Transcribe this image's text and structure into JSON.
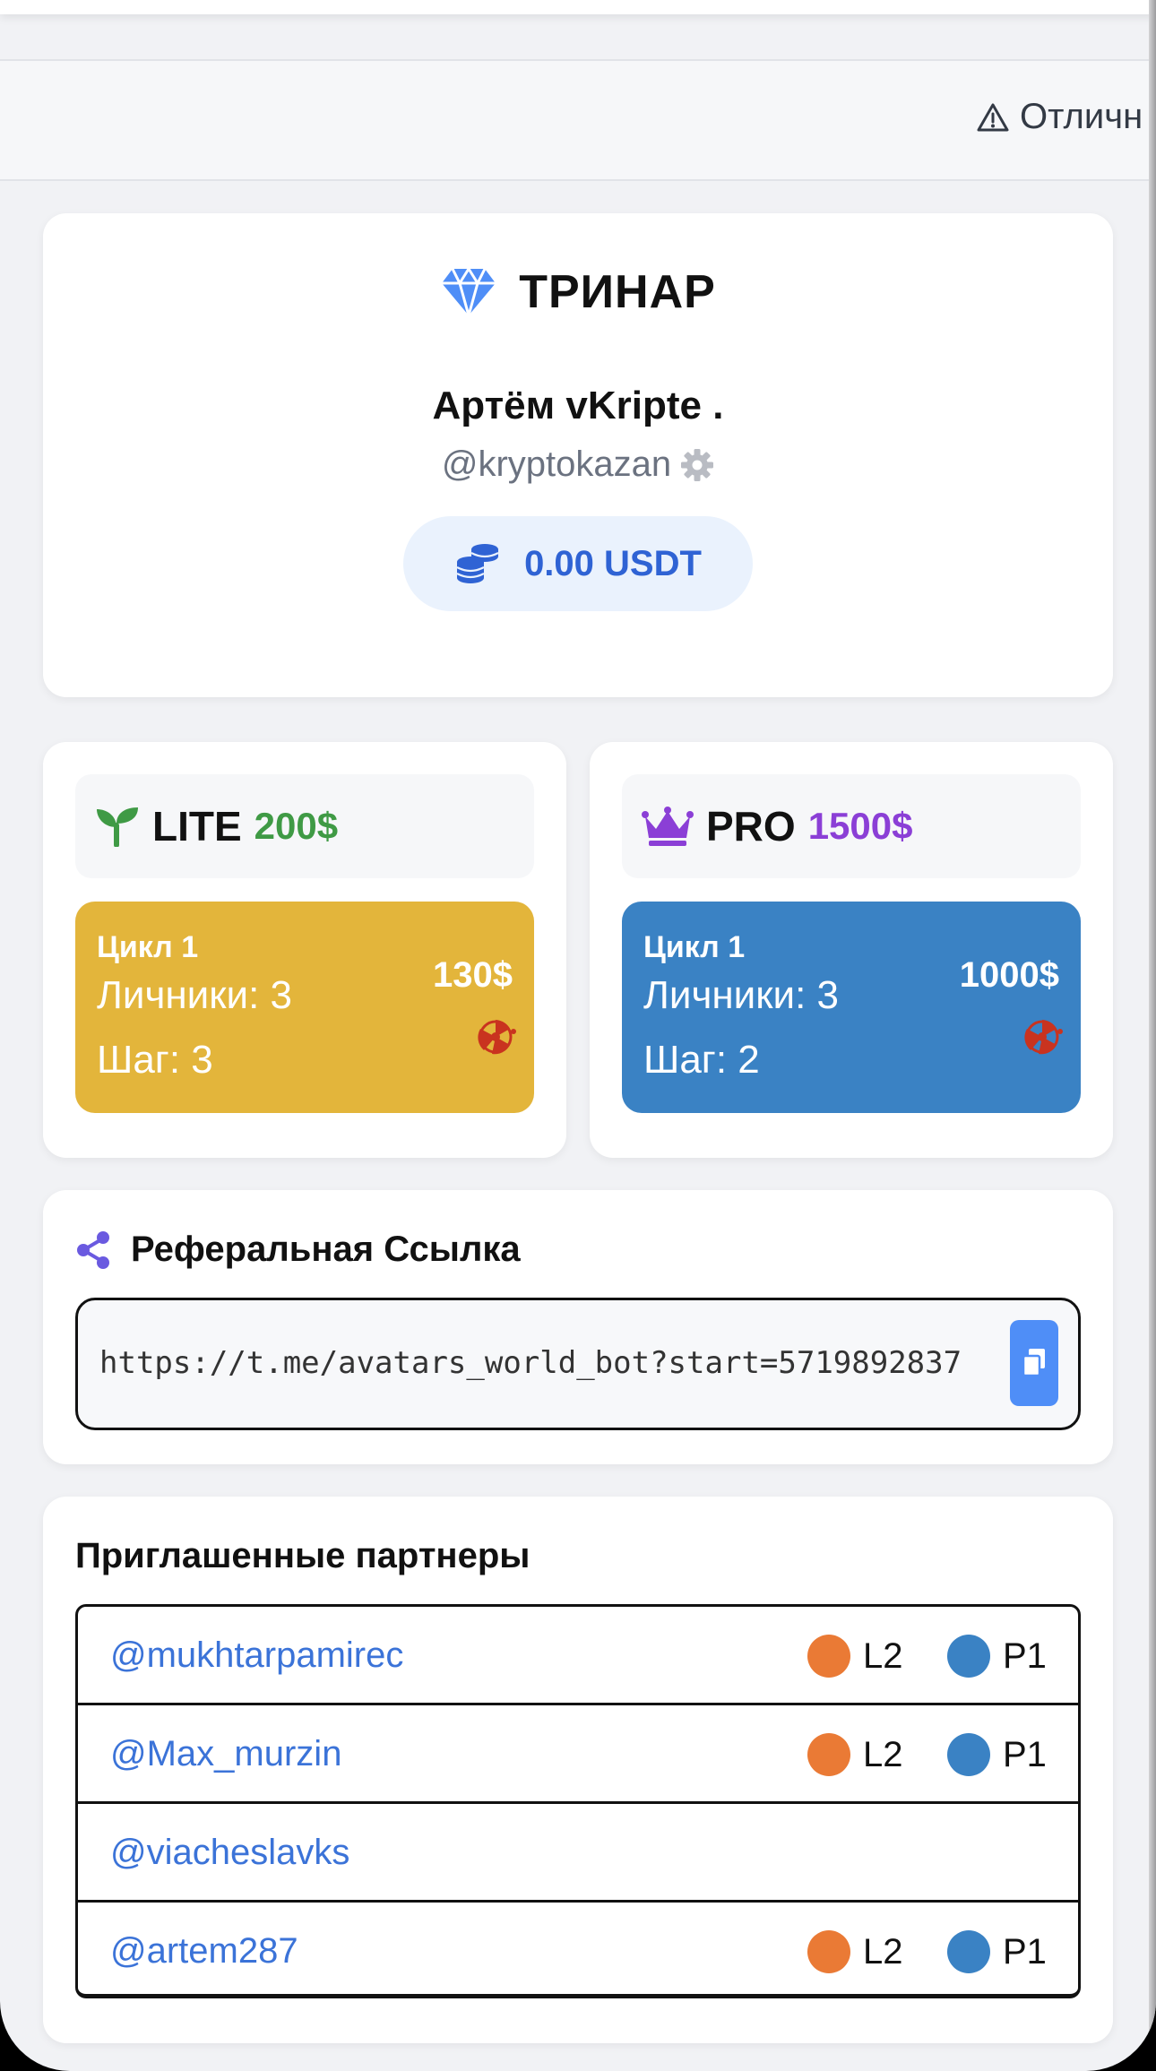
{
  "ticker": {
    "text": "Отличн"
  },
  "profile": {
    "brand": "ТРИНАР",
    "name": "Артём vKripte .",
    "handle": "@kryptokazan",
    "balance": "0.00 USDT"
  },
  "plans": {
    "lite": {
      "name": "LITE",
      "price": "200$",
      "cycle_title": "Цикл 1",
      "line1": "Личники: 3",
      "line2": "Шаг: 3",
      "amount": "130$"
    },
    "pro": {
      "name": "PRO",
      "price": "1500$",
      "cycle_title": "Цикл 1",
      "line1": "Личники: 3",
      "line2": "Шаг: 2",
      "amount": "1000$"
    }
  },
  "referral": {
    "title": "Реферальная Ссылка",
    "link": "https://t.me/avatars_world_bot?start=5719892837"
  },
  "partners": {
    "title": "Приглашенные партнеры",
    "rows": [
      {
        "handle": "@mukhtarpamirec",
        "level": "L2",
        "plan": "P1"
      },
      {
        "handle": "@Max_murzin",
        "level": "L2",
        "plan": "P1"
      },
      {
        "handle": "@viacheslavks",
        "level": "",
        "plan": ""
      },
      {
        "handle": "@artem287",
        "level": "L2",
        "plan": "P1"
      }
    ]
  },
  "colors": {
    "accent_blue": "#2f63d4",
    "lite_green": "#3f9a45",
    "pro_purple": "#8b3fd6",
    "lite_card": "#e3b53b",
    "pro_card": "#3a82c4",
    "level_dot": "#ea7a35",
    "plan_dot": "#3a82c4"
  }
}
